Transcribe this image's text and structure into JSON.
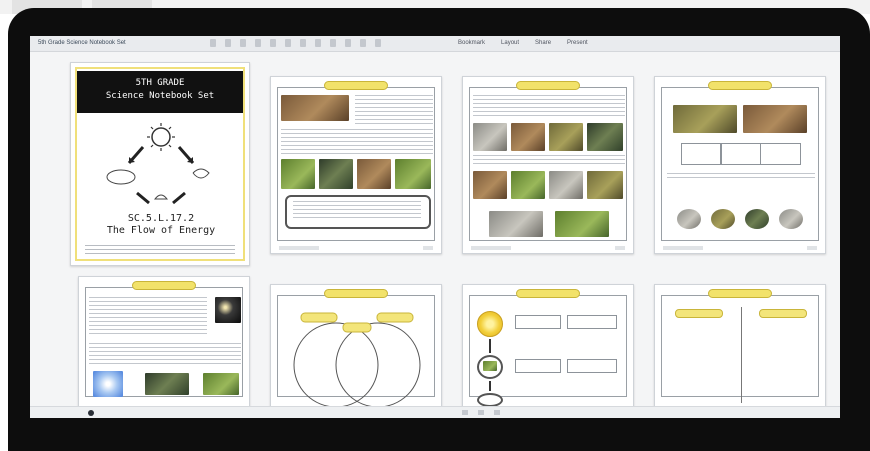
{
  "viewer": {
    "document_title": "5th Grade Science Notebook Set",
    "menus": [
      "Bookmark",
      "Layout",
      "Share",
      "Present"
    ]
  },
  "cover": {
    "banner_line1": "5TH GRADE",
    "banner_line2": "Science Notebook Set",
    "title_line1": "SC.5.L.17.2",
    "title_line2": "The Flow of Energy"
  },
  "pages": [
    {
      "label": "Notebook page 1"
    },
    {
      "label": "Notebook page 2"
    },
    {
      "label": "Notebook page 3"
    },
    {
      "label": "Notebook page 4"
    },
    {
      "label": "Notebook page 5"
    },
    {
      "label": "Notebook page 6"
    },
    {
      "label": "Notebook page 7"
    }
  ],
  "icons": {
    "sun": "sun-icon",
    "plant": "plant-icon",
    "arrow": "arrow-icon"
  },
  "colors": {
    "bezel": "#0d0d0d",
    "tag_yellow": "#f2e26a",
    "frame_yellow": "#f0e07a"
  }
}
